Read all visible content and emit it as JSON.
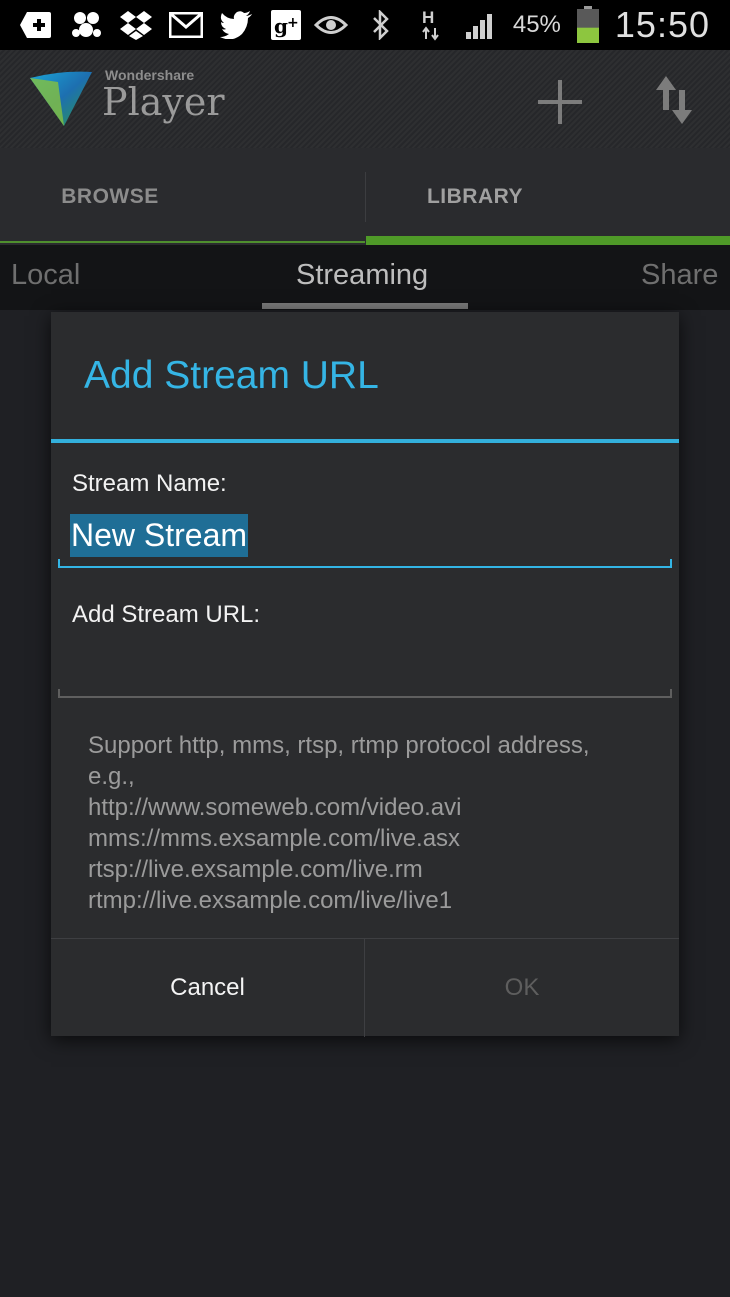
{
  "status_bar": {
    "icons": [
      "add-notification-icon",
      "bubbles-icon",
      "dropbox-icon",
      "gmail-icon",
      "twitter-icon",
      "google-plus-icon",
      "eye-icon",
      "bluetooth-icon",
      "hspa-data-icon",
      "signal-icon",
      "battery-icon"
    ],
    "battery_percent": "45%",
    "battery_level": 0.45,
    "time": "15:50"
  },
  "app_bar": {
    "brand_small": "Wondershare",
    "brand_name": "Player"
  },
  "tabs": [
    {
      "label": "BROWSE",
      "selected": false
    },
    {
      "label": "LIBRARY",
      "selected": true
    }
  ],
  "sub_tabs": [
    {
      "label": "Local",
      "selected": false
    },
    {
      "label": "Streaming",
      "selected": true
    },
    {
      "label": "Share",
      "selected": false
    }
  ],
  "dialog": {
    "title": "Add Stream URL",
    "name_label": "Stream Name:",
    "name_value": "New Stream",
    "url_label": "Add Stream URL:",
    "url_value": "",
    "help_lines": [
      "Support http, mms, rtsp, rtmp protocol address,",
      "e.g.,",
      "http://www.someweb.com/video.avi",
      "mms://mms.exsample.com/live.asx",
      "rtsp://live.exsample.com/live.rm",
      "rtmp://live.exsample.com/live/live1"
    ],
    "cancel_label": "Cancel",
    "ok_label": "OK"
  },
  "colors": {
    "accent_blue": "#33b5e5",
    "tab_green": "#4f9a28",
    "battery_green": "#8dc63f"
  }
}
